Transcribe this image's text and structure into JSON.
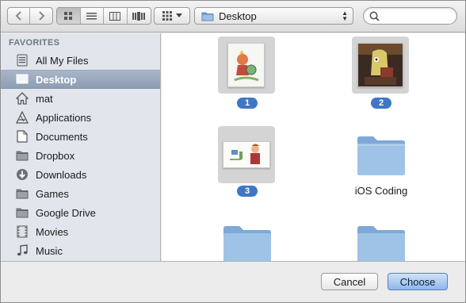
{
  "toolbar": {
    "back_icon": "chevron-left-icon",
    "forward_icon": "chevron-right-icon",
    "views": [
      "icon-view",
      "list-view",
      "column-view",
      "cover-flow-view"
    ],
    "active_view": "icon-view",
    "arrange_icon": "grid-arrange-icon",
    "location": "Desktop",
    "search_placeholder": ""
  },
  "sidebar": {
    "header": "FAVORITES",
    "items": [
      {
        "label": "All My Files",
        "icon": "all-my-files-icon"
      },
      {
        "label": "Desktop",
        "icon": "desktop-icon",
        "selected": true
      },
      {
        "label": "mat",
        "icon": "home-icon"
      },
      {
        "label": "Applications",
        "icon": "applications-icon"
      },
      {
        "label": "Documents",
        "icon": "documents-icon"
      },
      {
        "label": "Dropbox",
        "icon": "dropbox-icon"
      },
      {
        "label": "Downloads",
        "icon": "downloads-icon"
      },
      {
        "label": "Games",
        "icon": "folder-icon"
      },
      {
        "label": "Google Drive",
        "icon": "folder-icon"
      },
      {
        "label": "Movies",
        "icon": "movies-icon"
      },
      {
        "label": "Music",
        "icon": "music-icon"
      }
    ]
  },
  "files": [
    {
      "badge": "1",
      "kind": "image"
    },
    {
      "badge": "2",
      "kind": "image"
    },
    {
      "badge": "3",
      "kind": "image"
    },
    {
      "name": "iOS Coding",
      "kind": "folder"
    },
    {
      "name": "",
      "kind": "folder"
    },
    {
      "name": "",
      "kind": "folder"
    }
  ],
  "buttons": {
    "cancel": "Cancel",
    "choose": "Choose"
  },
  "colors": {
    "selection": "#8d9db4",
    "badge": "#3f76c6",
    "folder": "#8fb5dc",
    "default_button": "#8fb7ea"
  }
}
